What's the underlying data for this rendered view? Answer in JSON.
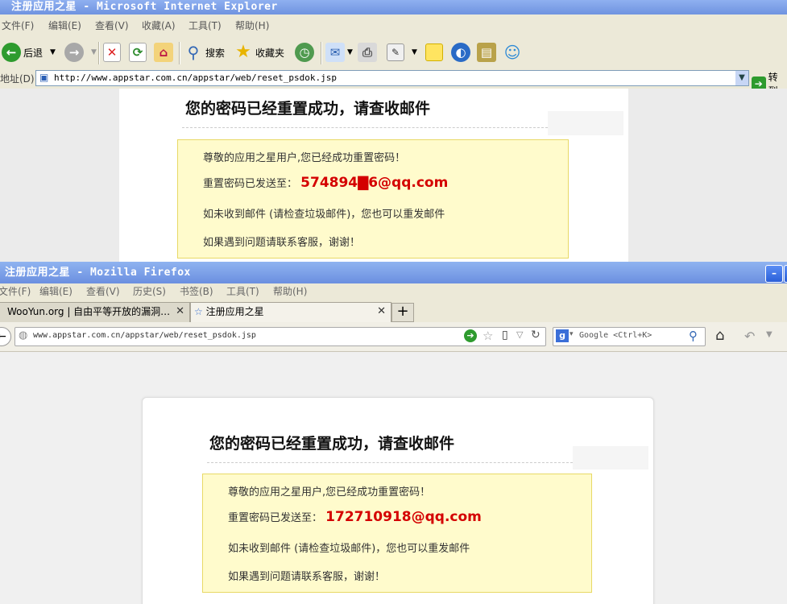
{
  "ie": {
    "title": "注册应用之星 - Microsoft Internet Explorer",
    "menu": [
      "文件(F)",
      "编辑(E)",
      "查看(V)",
      "收藏(A)",
      "工具(T)",
      "帮助(H)"
    ],
    "toolbar": {
      "back": "后退",
      "search": "搜索",
      "favorites": "收藏夹"
    },
    "address": {
      "label": "地址(D)",
      "url": "http://www.appstar.com.cn/appstar/web/reset_psdok.jsp",
      "go": "转到"
    },
    "page": {
      "title": "您的密码已经重置成功，请查收邮件",
      "greeting": "尊敬的应用之星用户,您已经成功重置密码！",
      "sent_label": "重置密码已发送至：",
      "email": "574894▇6@qq.com",
      "resend": "如未收到邮件 (请检查垃圾邮件)，您也可以重发邮件",
      "contact": "如果遇到问题请联系客服，谢谢！"
    }
  },
  "ff": {
    "title": "注册应用之星 - Mozilla Firefox",
    "menu": [
      "文件(F)",
      "编辑(E)",
      "查看(V)",
      "历史(S)",
      "书签(B)",
      "工具(T)",
      "帮助(H)"
    ],
    "tabs": [
      {
        "label": "WooYun.org | 自由平等开放的漏洞…"
      },
      {
        "label": "注册应用之星"
      }
    ],
    "url": "www.appstar.com.cn/appstar/web/reset_psdok.jsp",
    "search_placeholder": "Google <Ctrl+K>",
    "page": {
      "title": "您的密码已经重置成功，请查收邮件",
      "greeting": "尊敬的应用之星用户,您已经成功重置密码！",
      "sent_label": "重置密码已发送至：",
      "email": "172710918@qq.com",
      "resend": "如未收到邮件 (请检查垃圾邮件)，您也可以重发邮件",
      "contact": "如果遇到问题请联系客服，谢谢！"
    }
  },
  "colors": {
    "email_red": "#d40000",
    "notice_bg": "#fffbcc",
    "xp_blue": "#6f93e0"
  }
}
